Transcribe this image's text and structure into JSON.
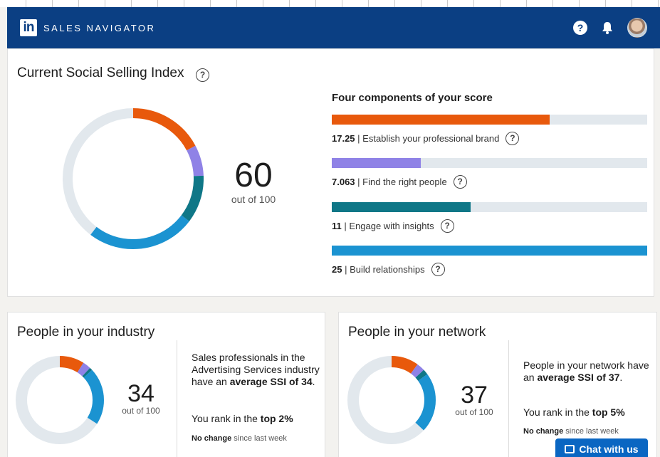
{
  "navbar": {
    "logo_text": "in",
    "brand": "SALES NAVIGATOR",
    "help_glyph": "?",
    "icons": [
      "help-icon",
      "bell-icon",
      "avatar"
    ]
  },
  "ssi": {
    "title": "Current Social Selling Index",
    "score": "60",
    "out_of": "out of 100",
    "components_title": "Four components of your score",
    "components": [
      {
        "value": "17.25",
        "label": "Establish your professional brand",
        "max": 25,
        "score": 17.25,
        "color": "#e8590c"
      },
      {
        "value": "7.063",
        "label": "Find the right people",
        "max": 25,
        "score": 7.063,
        "color": "#8f82e6"
      },
      {
        "value": "11",
        "label": "Engage with insights",
        "max": 25,
        "score": 11,
        "color": "#0f7787"
      },
      {
        "value": "25",
        "label": "Build relationships",
        "max": 25,
        "score": 25,
        "color": "#1b93d1"
      }
    ],
    "track_color": "#e2e8ed"
  },
  "industry": {
    "title": "People in your industry",
    "score": "34",
    "out_of": "out of 100",
    "desc_pre": "Sales professionals in the Advertising Services industry have an ",
    "desc_bold": "average SSI of 34",
    "desc_post": ".",
    "rank_pre": "You rank in the ",
    "rank_bold": "top 2%",
    "change_bold": "No change",
    "change_rest": " since last week",
    "segments": [
      9,
      3,
      1,
      21
    ]
  },
  "network": {
    "title": "People in your network",
    "score": "37",
    "out_of": "out of 100",
    "desc_pre": "People in your network have an ",
    "desc_bold": "average SSI of 37",
    "desc_post": ".",
    "rank_pre": "You rank in the ",
    "rank_bold": "top 5%",
    "change_bold": "No change",
    "change_rest": " since last week",
    "segments": [
      10,
      3,
      2,
      22
    ]
  },
  "chat": {
    "label": "Chat with us"
  }
}
